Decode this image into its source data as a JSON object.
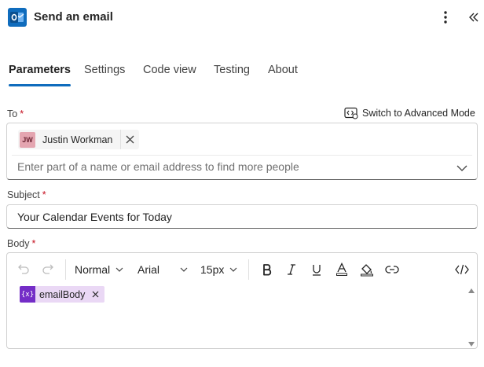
{
  "header": {
    "title": "Send an email",
    "icon": "outlook-icon",
    "brand_color": "#0f6cbd"
  },
  "tabs": [
    {
      "label": "Parameters",
      "active": true
    },
    {
      "label": "Settings",
      "active": false
    },
    {
      "label": "Code view",
      "active": false
    },
    {
      "label": "Testing",
      "active": false
    },
    {
      "label": "About",
      "active": false
    }
  ],
  "to": {
    "label": "To",
    "required_mark": "*",
    "advanced_mode_label": "Switch to Advanced Mode",
    "recipient": {
      "initials": "JW",
      "name": "Justin Workman"
    },
    "placeholder": "Enter part of a name or email address to find more people"
  },
  "subject": {
    "label": "Subject",
    "required_mark": "*",
    "value": "Your Calendar Events for Today"
  },
  "body": {
    "label": "Body",
    "required_mark": "*",
    "toolbar": {
      "format": "Normal",
      "font": "Arial",
      "size": "15px"
    },
    "token": {
      "icon_text": "{x}",
      "label": "emailBody"
    }
  },
  "colors": {
    "accent": "#0f6cbd",
    "required": "#c50f1f",
    "token_bg": "#ead8f5",
    "token_icon": "#742dc7",
    "avatar_bg": "#e4a5b0"
  }
}
